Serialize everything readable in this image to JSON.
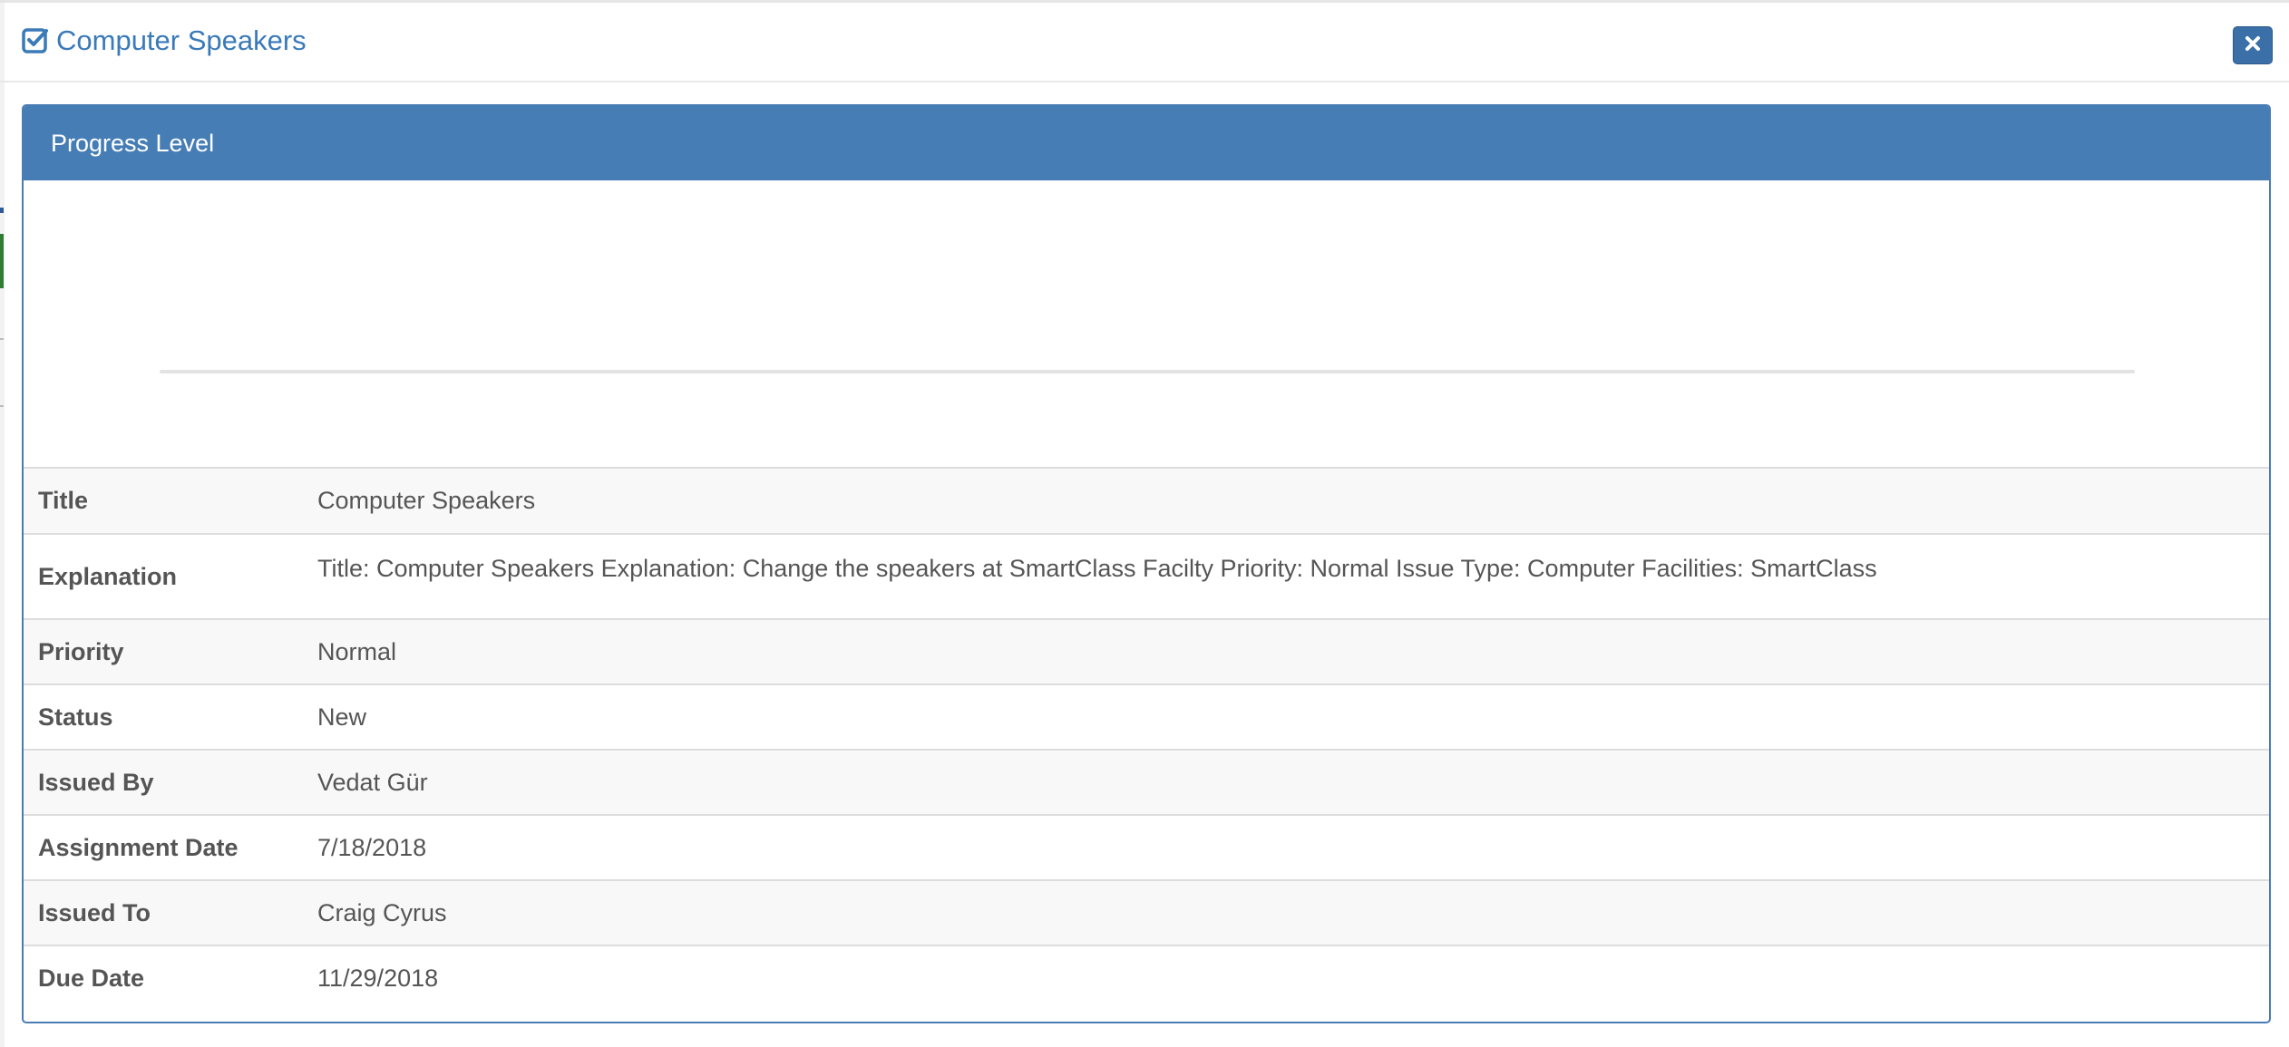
{
  "modal": {
    "title": "Computer Speakers",
    "title_icon": "check-square-icon",
    "close_icon": "close-icon",
    "accent_color": "#467db5"
  },
  "panel": {
    "heading": "Progress Level",
    "progress_percent": 0
  },
  "details": [
    {
      "label": "Title",
      "value": "Computer Speakers"
    },
    {
      "label": "Explanation",
      "value": "Title: Computer Speakers Explanation: Change the speakers at SmartClass Facilty Priority: Normal Issue Type: Computer Facilities: SmartClass"
    },
    {
      "label": "Priority",
      "value": "Normal"
    },
    {
      "label": "Status",
      "value": "New"
    },
    {
      "label": "Issued By",
      "value": "Vedat Gür"
    },
    {
      "label": "Assignment Date",
      "value": "7/18/2018"
    },
    {
      "label": "Issued To",
      "value": "Craig Cyrus"
    },
    {
      "label": "Due Date",
      "value": "11/29/2018"
    }
  ]
}
